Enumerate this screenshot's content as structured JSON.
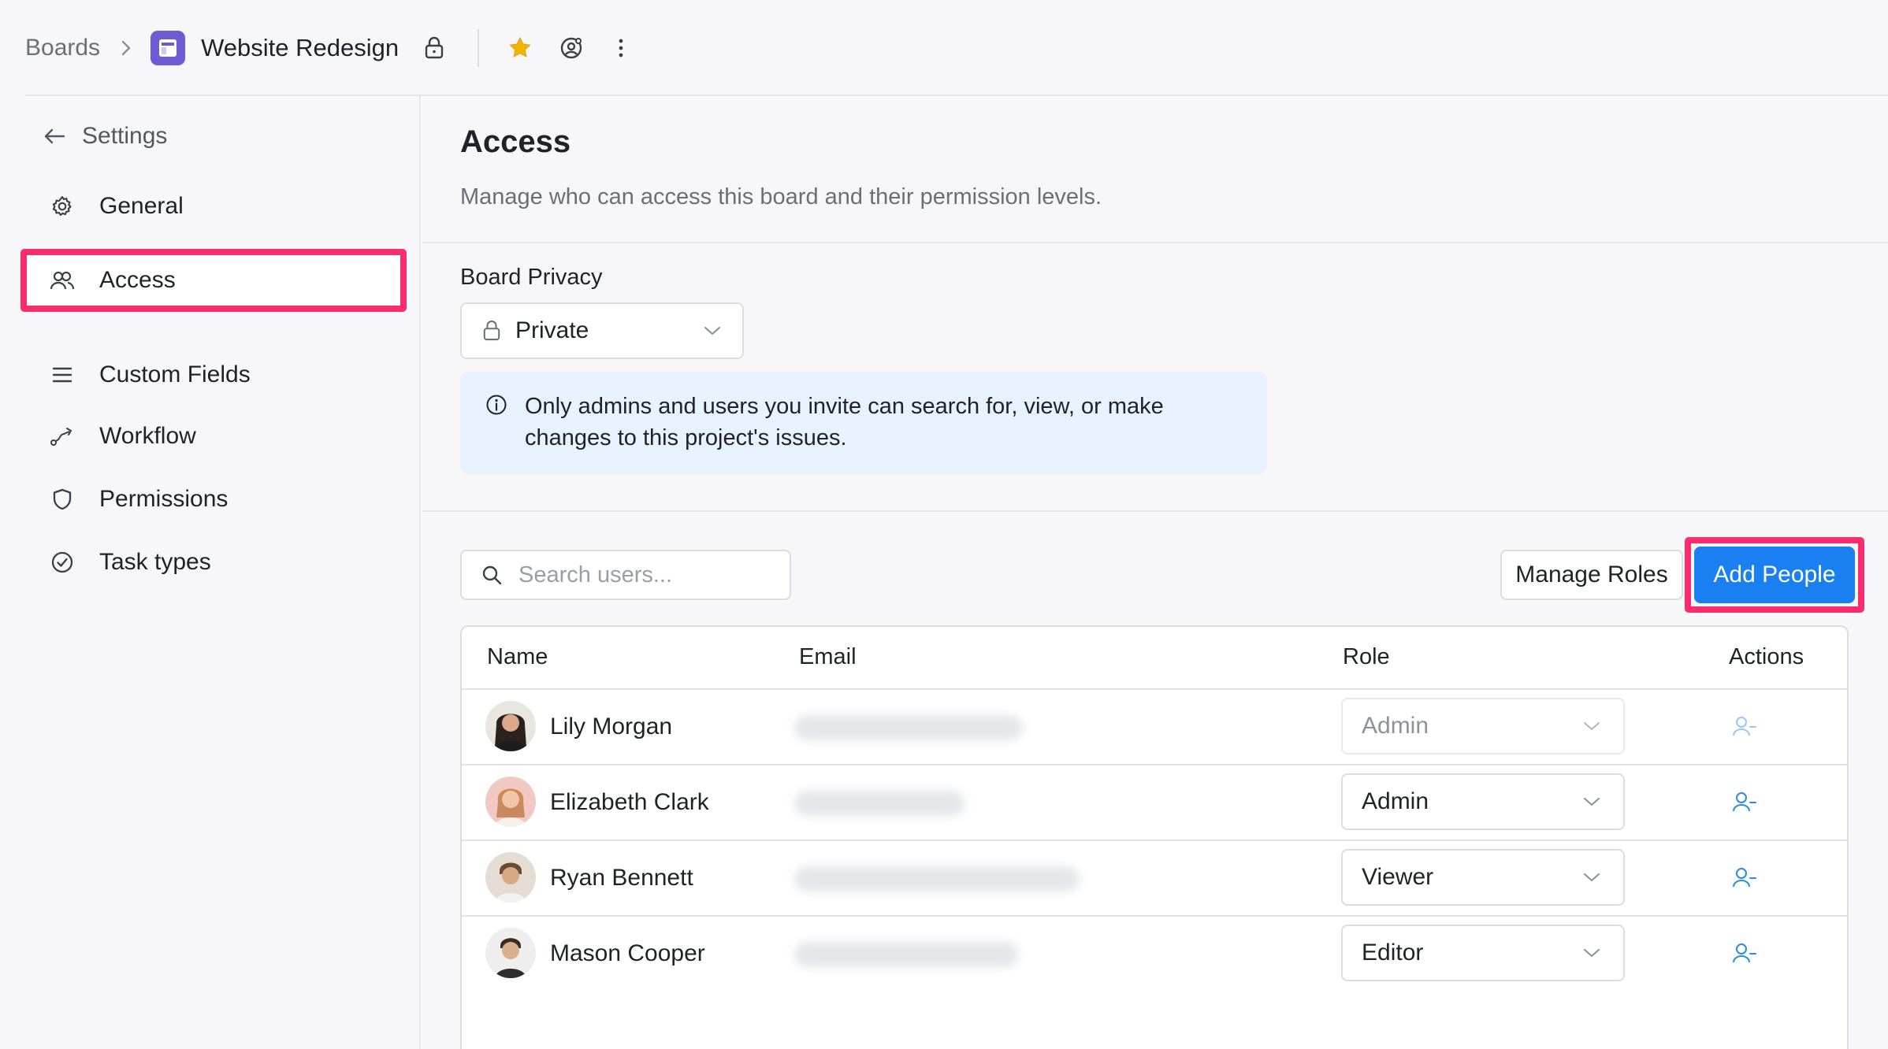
{
  "breadcrumb": {
    "root": "Boards",
    "board": "Website Redesign"
  },
  "icons": {
    "chevron_right": "chevron-right-icon",
    "board": "board-icon",
    "lock": "lock-icon",
    "star": "star-icon",
    "watch": "watch-icon",
    "more": "more-vertical-icon"
  },
  "colors": {
    "accent": "#1a7ff0",
    "highlight": "#f72d6e",
    "board_icon": "#6f5bd3",
    "star": "#f4b400",
    "info_bg": "#e8f2fc"
  },
  "sidebar": {
    "back_label": "Settings",
    "items": [
      {
        "label": "General",
        "icon": "gear-icon"
      },
      {
        "label": "Access",
        "icon": "users-icon",
        "active": true
      },
      {
        "label": "Custom Fields",
        "icon": "list-icon"
      },
      {
        "label": "Workflow",
        "icon": "workflow-icon"
      },
      {
        "label": "Permissions",
        "icon": "shield-icon"
      },
      {
        "label": "Task types",
        "icon": "check-circle-icon"
      }
    ]
  },
  "main": {
    "title": "Access",
    "subtitle": "Manage who can access this board and their permission levels.",
    "privacy": {
      "label": "Board Privacy",
      "value": "Private",
      "info": "Only admins and users you invite can search for, view, or make changes to this project's issues."
    },
    "search": {
      "placeholder": "Search users...",
      "value": ""
    },
    "manage_roles_label": "Manage Roles",
    "add_people_label": "Add People",
    "table": {
      "columns": [
        "Name",
        "Email",
        "Role",
        "Actions"
      ],
      "rows": [
        {
          "name": "Lily Morgan",
          "role": "Admin",
          "role_disabled": true
        },
        {
          "name": "Elizabeth Clark",
          "role": "Admin",
          "role_disabled": false
        },
        {
          "name": "Ryan Bennett",
          "role": "Viewer",
          "role_disabled": false
        },
        {
          "name": "Mason Cooper",
          "role": "Editor",
          "role_disabled": false
        }
      ]
    }
  }
}
